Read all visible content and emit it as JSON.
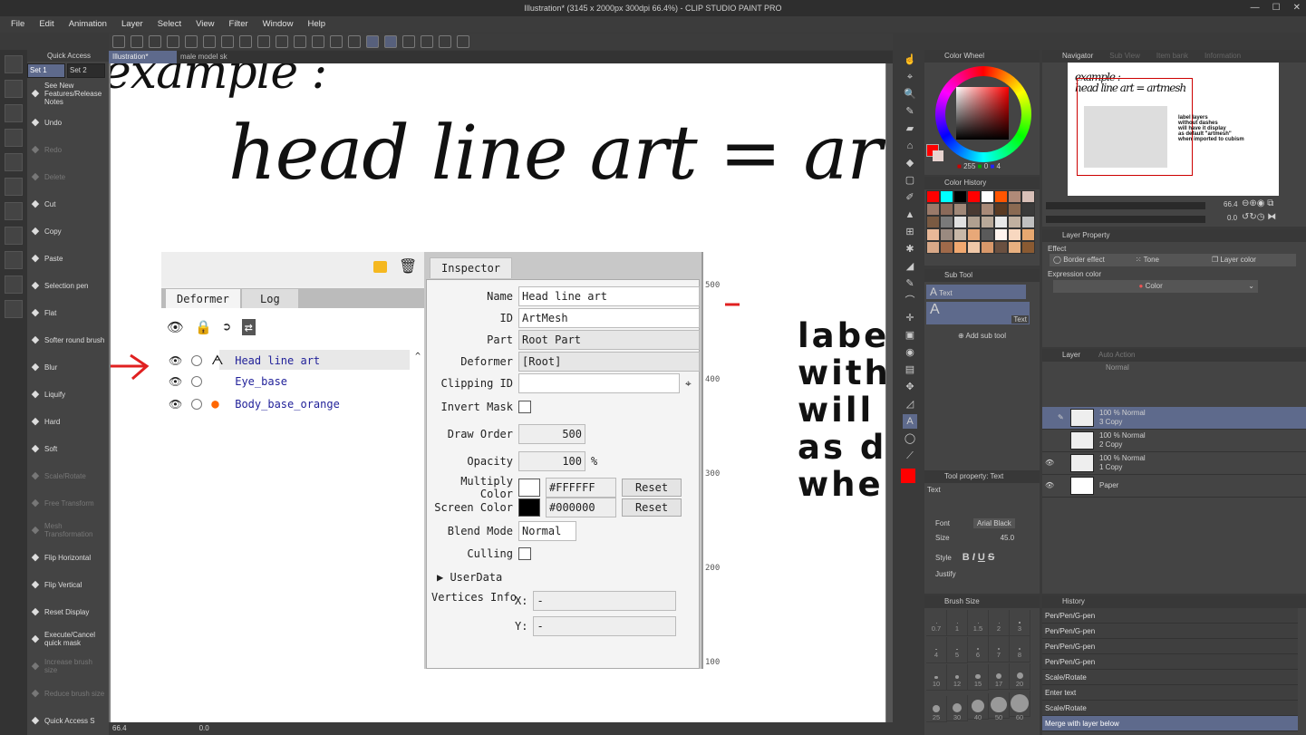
{
  "window": {
    "title": "Illustration* (3145 x 2000px 300dpi 66.4%) - CLIP STUDIO PAINT PRO",
    "min": "—",
    "max": "☐",
    "close": "✕"
  },
  "menu": [
    "File",
    "Edit",
    "Animation",
    "Layer",
    "Select",
    "View",
    "Filter",
    "Window",
    "Help"
  ],
  "quick_access": {
    "title": "Quick Access",
    "sets": [
      "Set 1",
      "Set 2"
    ],
    "items": [
      {
        "label": "See New Features/Release Notes",
        "icon": "new-icon"
      },
      {
        "label": "Undo",
        "icon": "undo-icon"
      },
      {
        "label": "Redo",
        "icon": "redo-icon",
        "dim": true
      },
      {
        "label": "Delete",
        "icon": "delete-icon",
        "dim": true
      },
      {
        "label": "Cut",
        "icon": "scissors-icon"
      },
      {
        "label": "Copy",
        "icon": "copy-icon"
      },
      {
        "label": "Paste",
        "icon": "paste-icon"
      },
      {
        "label": "Selection pen",
        "icon": "selection-pen-icon"
      },
      {
        "label": "Flat",
        "icon": "brush-icon"
      },
      {
        "label": "Softer round brush",
        "icon": "brush-icon"
      },
      {
        "label": "Blur",
        "icon": "blur-icon"
      },
      {
        "label": "Liquify",
        "icon": "liquify-icon"
      },
      {
        "label": "Hard",
        "icon": "eraser-icon"
      },
      {
        "label": "Soft",
        "icon": "eraser-icon"
      },
      {
        "label": "Scale/Rotate",
        "icon": "scale-icon",
        "dim": true
      },
      {
        "label": "Free Transform",
        "icon": "transform-icon",
        "dim": true
      },
      {
        "label": "Mesh Transformation",
        "icon": "mesh-icon",
        "dim": true
      },
      {
        "label": "Flip Horizontal",
        "icon": "flip-horizontal-icon"
      },
      {
        "label": "Flip Vertical",
        "icon": "flip-vertical-icon"
      },
      {
        "label": "Reset Display",
        "icon": "reset-display-icon"
      },
      {
        "label": "Execute/Cancel quick mask",
        "icon": "quick-mask-icon"
      },
      {
        "label": "Increase brush size",
        "icon": "brush-size-icon",
        "dim": true
      },
      {
        "label": "Reduce brush size",
        "icon": "brush-size-icon",
        "dim": true
      },
      {
        "label": "Quick Access S",
        "icon": "settings-icon"
      }
    ]
  },
  "canvas_tabs": [
    "Illustration*",
    "male model sk"
  ],
  "status": {
    "zoom": "66.4",
    "angle": "0.0"
  },
  "canvas": {
    "line1": "example :",
    "line2": "head line art = artm",
    "side_text": "labe\nwith\nwill\nas d\nwhe"
  },
  "embedded": {
    "deformer_tabs": [
      "Deformer",
      "Log"
    ],
    "tree": [
      {
        "name": "Head line art",
        "icon": "artmesh-icon"
      },
      {
        "name": "Eye_base"
      },
      {
        "name": "Body_base_orange",
        "icon": "orange-blob-icon"
      }
    ],
    "inspector_tab": "Inspector",
    "fields": {
      "name_label": "Name",
      "name": "Head line art",
      "id_label": "ID",
      "id": "ArtMesh",
      "part_label": "Part",
      "part": "Root Part",
      "deformer_label": "Deformer",
      "deformer": "[Root]",
      "clip_label": "Clipping ID",
      "clip": "",
      "invert_label": "Invert Mask",
      "draw_label": "Draw Order",
      "draw": "500",
      "opacity_label": "Opacity",
      "opacity": "100",
      "pct": "%",
      "mult_label": "Multiply Color",
      "mult": "#FFFFFF",
      "screen_label": "Screen Color",
      "screen": "#000000",
      "reset": "Reset",
      "blend_label": "Blend Mode",
      "blend": "Normal",
      "culling_label": "Culling",
      "userdata": "▶ UserData",
      "vert_label": "Vertices Info",
      "x_label": "X:",
      "y_label": "Y:",
      "x": "-",
      "y": "-"
    },
    "ruler": [
      "500",
      "400",
      "300",
      "200",
      "100"
    ]
  },
  "color_wheel": {
    "title": "Color Wheel",
    "r": "255",
    "g": "0",
    "b": "4",
    "main": "#ff0000",
    "sub": "#e8d4d0"
  },
  "color_history": {
    "title": "Color History",
    "swatches": [
      "#ff0000",
      "#00ffff",
      "#000000",
      "#ff0000",
      "#ffffff",
      "#ff5500",
      "#b08a78",
      "#d8c0b8",
      "#9a7a6a",
      "#8a6a5a",
      "#a08878",
      "#4a3a32",
      "#a88a78",
      "#5a3a22",
      "#8a6a52",
      "#3a3a3a",
      "#7a5a42",
      "#7a7a7a",
      "#e0e0e0",
      "#b0a090",
      "#b8a898",
      "#e8e8e8",
      "#c0b0a0",
      "#c0c0c0",
      "#e8b898",
      "#9a8a80",
      "#c8b8a8",
      "#e8a878",
      "#5a5a5a",
      "#fff4ee",
      "#f8d8c0",
      "#e8a870",
      "#d8a888",
      "#a06a4a",
      "#f0a870",
      "#f0c8a8",
      "#d8986a",
      "#6a5040",
      "#e8b080",
      "#8a5a32"
    ]
  },
  "sub_tool": {
    "title": "Sub Tool",
    "items": [
      "Text"
    ],
    "card": "Text",
    "add": "Add sub tool"
  },
  "tool_property": {
    "title": "Tool property: Text",
    "name": "Text",
    "font_label": "Font",
    "font": "Arial Black",
    "size_label": "Size",
    "size": "45.0",
    "style_label": "Style",
    "justify_label": "Justify"
  },
  "brush_size": {
    "title": "Brush Size",
    "sizes": [
      "0.7",
      "1",
      "1.5",
      "2",
      "3",
      "4",
      "5",
      "6",
      "7",
      "8",
      "10",
      "12",
      "15",
      "17",
      "20",
      "25",
      "30",
      "40",
      "50",
      "60"
    ]
  },
  "navigator": {
    "tabs": [
      "Navigator",
      "Sub View",
      "Item bank",
      "Information"
    ],
    "zoom": "66.4",
    "rotate": "0.0",
    "mini_title": "example :\nhead line art = artmesh",
    "mini_note": "label layers\nwithout dashes\nwill have it display\nas default \"artmesh\"\nwhen imported to cubism"
  },
  "layer_property": {
    "title": "Layer Property",
    "effect": "Effect",
    "border": "Border effect",
    "tone": "Tone",
    "layer_color": "Layer color",
    "expr": "Expression color",
    "color": "Color"
  },
  "layers": {
    "tabs": [
      "Layer",
      "Auto Action"
    ],
    "blend": "Normal",
    "items": [
      {
        "l1": "100 % Normal",
        "l2": "3 Copy",
        "sel": true
      },
      {
        "l1": "100 % Normal",
        "l2": "2 Copy"
      },
      {
        "l1": "100 % Normal",
        "l2": "1 Copy"
      },
      {
        "l1": "",
        "l2": "Paper"
      }
    ]
  },
  "history": {
    "title": "History",
    "items": [
      "Pen/Pen/G-pen",
      "Pen/Pen/G-pen",
      "Pen/Pen/G-pen",
      "Pen/Pen/G-pen",
      "Scale/Rotate",
      "Enter text",
      "Scale/Rotate",
      "Merge with layer below"
    ]
  }
}
